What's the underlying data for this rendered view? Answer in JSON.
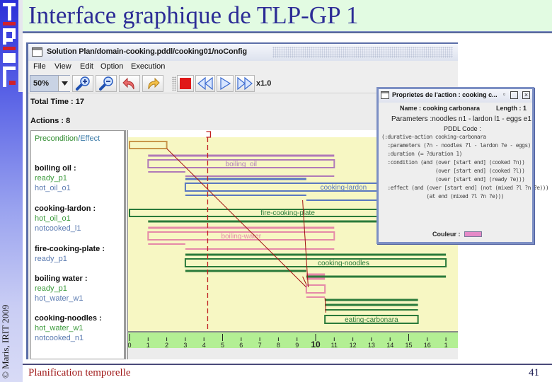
{
  "slide": {
    "title": "Interface graphique de TLP-GP 1",
    "copyright": "© Maris, IRIT 2009",
    "footer": "Planification temporelle",
    "page_number": "41",
    "logo_text": "IRIT"
  },
  "app": {
    "window_title": "Solution Plan/domain-cooking.pddl/cooking01/noConfig",
    "menu": [
      "File",
      "View",
      "Edit",
      "Option",
      "Execution"
    ],
    "toolbar": {
      "zoom_value": "50%",
      "speed": "x1.0",
      "buttons": [
        "zoom-in",
        "zoom-out",
        "undo",
        "redo",
        "stop",
        "rewind",
        "play",
        "fast-forward"
      ]
    },
    "total_time": "Total Time : 17",
    "actions_count": "Actions : 8"
  },
  "list": {
    "header_pre": "Precondition",
    "header_sep": "/",
    "header_eff": "Effect",
    "actions": [
      {
        "name": "boiling oil :",
        "pre": "ready_p1",
        "eff": "hot_oil_o1"
      },
      {
        "name": "cooking-lardon :",
        "pre": "hot_oil_o1",
        "eff": "notcooked_l1"
      },
      {
        "name": "fire-cooking-plate :",
        "pre": "",
        "eff": "ready_p1"
      },
      {
        "name": "boiling water :",
        "pre": "ready_p1",
        "eff": "hot_water_w1"
      },
      {
        "name": "cooking-noodles :",
        "pre": "hot_water_w1",
        "eff": "notcooked_n1"
      }
    ]
  },
  "gantt": {
    "current_time": 4.2,
    "axis_max": 17,
    "ticks": [
      "0",
      "1",
      "2",
      "3",
      "4",
      "5",
      "6",
      "7",
      "8",
      "9",
      "10",
      "11",
      "12",
      "13",
      "14",
      "15",
      "16",
      "1"
    ],
    "bars": [
      {
        "label": "",
        "start": 0,
        "end": 2,
        "color": "#c8964a"
      },
      {
        "label": "boiling_oil",
        "start": 1,
        "end": 11,
        "color": "#b07ab8"
      },
      {
        "label": "cooking-lardon",
        "start": 3,
        "end": 17,
        "color": "#5a78c0"
      },
      {
        "label": "fire-cooking-plate",
        "start": 0,
        "end": 17,
        "color": "#2a7a3a"
      },
      {
        "label": "boiling-water",
        "start": 1,
        "end": 11,
        "color": "#e58aa8"
      },
      {
        "label": "cooking-noodles",
        "start": 3,
        "end": 17,
        "color": "#2a7a3a"
      },
      {
        "label": "",
        "start": 9.5,
        "end": 10.5,
        "color": "#e58aa8"
      },
      {
        "label": "eating-carbonara",
        "start": 10.5,
        "end": 15.5,
        "color": "#2a7a3a"
      }
    ]
  },
  "props": {
    "title": "Proprietes de l'action : cooking c...",
    "name": "Name : cooking carbonara",
    "length": "Length : 1",
    "parameters": "Parameters :noodles n1 - lardon l1 - eggs e1",
    "pddl_label": "PDDL Code :",
    "code": [
      "(:durative-action cooking-carbonara",
      "  :parameters (?n - noodles ?l - lardon ?e - eggs)",
      "  :duration (= ?duration 1)",
      "  :condition (and (over [start end] (cooked ?n))",
      "                  (over [start end] (cooked ?l))",
      "                  (over [start end] (ready ?e)))",
      "  :effect (and (over [start end] (not (mixed ?l ?n ?e)))",
      "               (at end (mixed ?l ?n ?e)))"
    ],
    "color_label": "Couleur :",
    "color": "#e58ac8"
  }
}
